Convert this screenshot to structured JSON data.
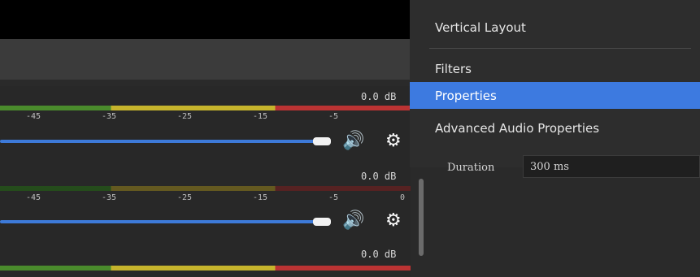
{
  "mixer": {
    "channels": [
      {
        "db": "0.0 dB",
        "ticks": [
          "-45",
          "-35",
          "-25",
          "-15",
          "-5"
        ]
      },
      {
        "db": "0.0 dB",
        "ticks": [
          "-45",
          "-35",
          "-25",
          "-15",
          "-5",
          "0"
        ]
      },
      {
        "db": "0.0 dB"
      }
    ]
  },
  "context_menu": {
    "items": [
      {
        "label": "Vertical Layout"
      },
      {
        "label": "Filters"
      },
      {
        "label": "Properties"
      },
      {
        "label": "Advanced Audio Properties"
      }
    ],
    "selected": "Properties"
  },
  "fade_filter": {
    "duration_label": "Duration",
    "duration_value": "300 ms"
  },
  "icons": {
    "speaker": "speaker-icon",
    "gear": "gear-icon"
  },
  "colors": {
    "selection": "#3d7ae0",
    "fader": "#3d7ad9",
    "meter_green": "#4a8b2c",
    "meter_yellow": "#c6b42c",
    "meter_red": "#b33"
  }
}
